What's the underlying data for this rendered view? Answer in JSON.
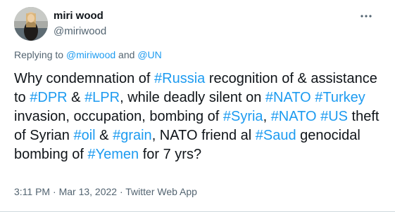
{
  "author": {
    "name": "miri wood",
    "handle": "@miriwood"
  },
  "more_icon": "more-horizontal-icon",
  "reply_context": {
    "prefix": "Replying to ",
    "mention1": "@miriwood",
    "conjunction": " and ",
    "mention2": "@UN"
  },
  "tweet_body": [
    {
      "text": "Why condemnation of ",
      "tag": false
    },
    {
      "text": "#Russia",
      "tag": true
    },
    {
      "text": " recognition of & assistance to ",
      "tag": false
    },
    {
      "text": "#DPR",
      "tag": true
    },
    {
      "text": " & ",
      "tag": false
    },
    {
      "text": "#LPR",
      "tag": true
    },
    {
      "text": ", while deadly silent on ",
      "tag": false
    },
    {
      "text": "#NATO",
      "tag": true
    },
    {
      "text": " ",
      "tag": false
    },
    {
      "text": "#Turkey",
      "tag": true
    },
    {
      "text": " invasion, occupation, bombing of ",
      "tag": false
    },
    {
      "text": "#Syria",
      "tag": true
    },
    {
      "text": ", ",
      "tag": false
    },
    {
      "text": "#NATO",
      "tag": true
    },
    {
      "text": " ",
      "tag": false
    },
    {
      "text": "#US",
      "tag": true
    },
    {
      "text": " theft of Syrian ",
      "tag": false
    },
    {
      "text": "#oil",
      "tag": true
    },
    {
      "text": " & ",
      "tag": false
    },
    {
      "text": "#grain",
      "tag": true
    },
    {
      "text": ", NATO friend al ",
      "tag": false
    },
    {
      "text": "#Saud",
      "tag": true
    },
    {
      "text": " genocidal bombing of ",
      "tag": false
    },
    {
      "text": "#Yemen",
      "tag": true
    },
    {
      "text": " for 7 yrs?",
      "tag": false
    }
  ],
  "meta": {
    "time": "3:11 PM",
    "separator1": " · ",
    "date": "Mar 13, 2022",
    "separator2": " · ",
    "source": "Twitter Web App"
  },
  "colors": {
    "link": "#1d9bf0",
    "text": "#0f1419",
    "secondary": "#536471"
  }
}
